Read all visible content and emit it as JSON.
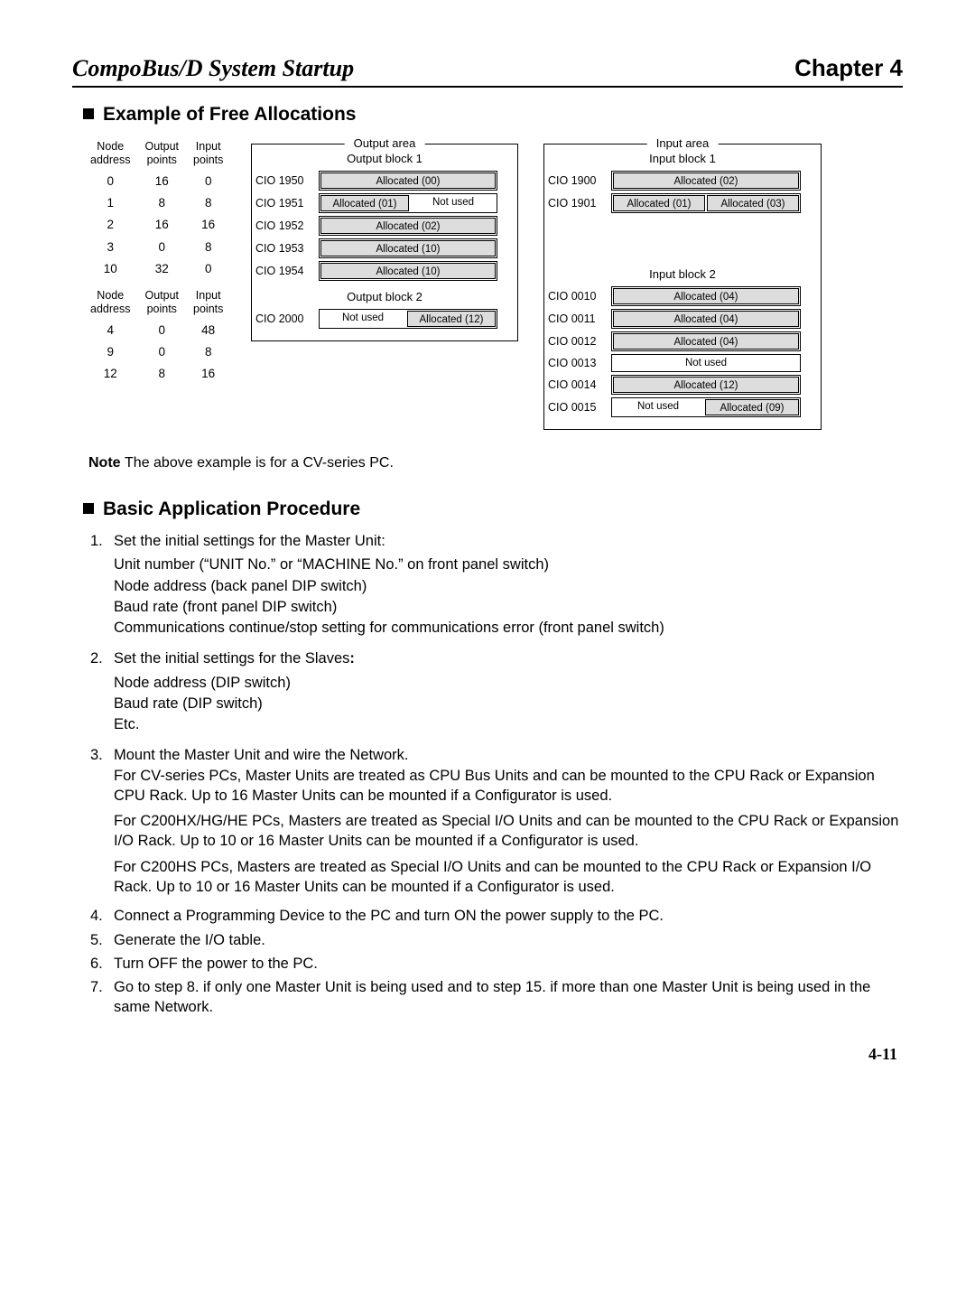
{
  "header": {
    "left": "CompoBus/D System Startup",
    "right": "Chapter 4"
  },
  "section1_title": "Example of Free Allocations",
  "nodes_tbl1": {
    "h1": "Node",
    "h1b": "address",
    "h2": "Output",
    "h2b": "points",
    "h3": "Input",
    "h3b": "points",
    "r": [
      [
        "0",
        "16",
        "0"
      ],
      [
        "1",
        "8",
        "8"
      ],
      [
        "2",
        "16",
        "16"
      ],
      [
        "3",
        "0",
        "8"
      ],
      [
        "10",
        "32",
        "0"
      ]
    ]
  },
  "nodes_tbl2": {
    "h1": "Node",
    "h1b": "address",
    "h2": "Output",
    "h2b": "points",
    "h3": "Input",
    "h3b": "points",
    "r": [
      [
        "4",
        "0",
        "48"
      ],
      [
        "9",
        "0",
        "8"
      ],
      [
        "12",
        "8",
        "16"
      ]
    ]
  },
  "output_area_legend": "Output area",
  "input_area_legend": "Input area",
  "out_blk1": "Output block 1",
  "out_blk2": "Output block 2",
  "in_blk1": "Input block 1",
  "in_blk2": "Input block 2",
  "out1": [
    {
      "cio": "CIO 1950",
      "left": {
        "t": "Allocated (00)",
        "s": true,
        "w": 1
      }
    },
    {
      "cio": "CIO 1951",
      "left": {
        "t": "Allocated (01)",
        "s": true,
        "w": 0.5
      },
      "right": {
        "t": "Not used",
        "s": false,
        "w": 0.5
      }
    },
    {
      "cio": "CIO 1952",
      "left": {
        "t": "Allocated (02)",
        "s": true,
        "w": 1
      }
    },
    {
      "cio": "CIO 1953",
      "left": {
        "t": "Allocated (10)",
        "s": true,
        "w": 1
      }
    },
    {
      "cio": "CIO 1954",
      "left": {
        "t": "Allocated (10)",
        "s": true,
        "w": 1
      }
    }
  ],
  "out2": [
    {
      "cio": "CIO 2000",
      "left": {
        "t": "Not used",
        "s": false,
        "w": 0.5
      },
      "right": {
        "t": "Allocated (12)",
        "s": true,
        "w": 0.5
      }
    }
  ],
  "in1": [
    {
      "cio": "CIO 1900",
      "left": {
        "t": "Allocated (02)",
        "s": true,
        "w": 1
      }
    },
    {
      "cio": "CIO 1901",
      "left": {
        "t": "Allocated (01)",
        "s": true,
        "w": 0.5
      },
      "right": {
        "t": "Allocated (03)",
        "s": true,
        "w": 0.5
      }
    }
  ],
  "in2": [
    {
      "cio": "CIO 0010",
      "left": {
        "t": "Allocated (04)",
        "s": true,
        "w": 1
      }
    },
    {
      "cio": "CIO 0011",
      "left": {
        "t": "Allocated (04)",
        "s": true,
        "w": 1
      }
    },
    {
      "cio": "CIO 0012",
      "left": {
        "t": "Allocated (04)",
        "s": true,
        "w": 1
      }
    },
    {
      "cio": "CIO 0013",
      "left": {
        "t": "Not used",
        "s": false,
        "w": 1
      }
    },
    {
      "cio": "CIO 0014",
      "left": {
        "t": "Allocated (12)",
        "s": true,
        "w": 1
      }
    },
    {
      "cio": "CIO 0015",
      "left": {
        "t": "Not used",
        "s": false,
        "w": 0.5
      },
      "right": {
        "t": "Allocated (09)",
        "s": true,
        "w": 0.5
      }
    }
  ],
  "note_label": "Note",
  "note_text": "The above example is for a CV-series PC.",
  "section2_title": "Basic Application Procedure",
  "proc": [
    {
      "n": "1.",
      "lead": "Set the initial settings for the Master Unit:",
      "subs": [
        "Unit number (“UNIT No.” or “MACHINE No.” on front panel switch)",
        "Node address (back panel DIP switch)",
        "Baud rate (front panel DIP switch)",
        "Communications continue/stop setting for communications error (front panel switch)"
      ]
    },
    {
      "n": "2.",
      "lead_prefix": "Set the initial settings for the Slaves",
      "lead_bold_suffix": ":",
      "subs": [
        "Node address (DIP switch)",
        "Baud rate (DIP switch)",
        "Etc."
      ]
    },
    {
      "n": "3.",
      "lead": "Mount the Master Unit and wire the Network.",
      "paras": [
        "For CV-series PCs, Master Units are treated as CPU Bus Units and can be mounted to the CPU Rack or Expansion CPU Rack. Up to 16 Master Units can be mounted if a Configurator is used.",
        "For C200HX/HG/HE PCs, Masters are treated as Special I/O Units and can be mounted to the CPU Rack or Expansion I/O Rack. Up to 10 or 16 Master Units can be mounted if a Configurator is used.",
        "For C200HS PCs, Masters are treated as Special I/O Units and can be mounted to the CPU Rack or Expansion I/O Rack. Up to 10 or 16 Master Units can be mounted if a Configurator is used."
      ]
    },
    {
      "n": "4.",
      "lead": "Connect a Programming Device to the PC and turn ON the power supply to the PC."
    },
    {
      "n": "5.",
      "lead": "Generate the I/O table."
    },
    {
      "n": "6.",
      "lead": "Turn OFF the power to the PC."
    },
    {
      "n": "7.",
      "lead": "Go to step 8. if only one Master Unit is being used and to step 15. if more than one Master Unit is being used in the same Network."
    }
  ],
  "page_number": "4-11"
}
